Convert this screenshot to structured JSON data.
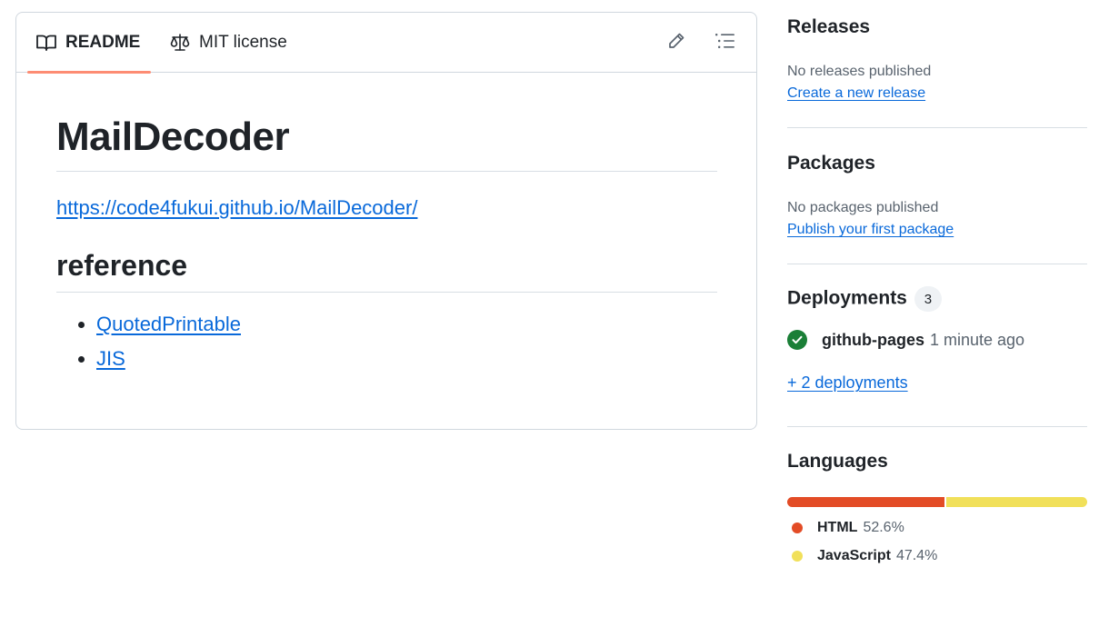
{
  "readme": {
    "tabs": [
      {
        "label": "README",
        "icon": "book-icon",
        "active": true
      },
      {
        "label": "MIT license",
        "icon": "law-icon",
        "active": false
      }
    ],
    "title": "MailDecoder",
    "site_link": "https://code4fukui.github.io/MailDecoder/",
    "reference_heading": "reference",
    "references": [
      "QuotedPrintable",
      "JIS"
    ]
  },
  "sidebar": {
    "releases": {
      "title": "Releases",
      "status": "No releases published",
      "link": "Create a new release"
    },
    "packages": {
      "title": "Packages",
      "status": "No packages published",
      "link": "Publish your first package"
    },
    "deployments": {
      "title": "Deployments",
      "count": "3",
      "latest_name": "github-pages",
      "latest_time": "1 minute ago",
      "more_link": "+ 2 deployments"
    },
    "languages": {
      "title": "Languages",
      "items": [
        {
          "name": "HTML",
          "percent": "52.6%",
          "value": 52.6,
          "color": "#e34c26"
        },
        {
          "name": "JavaScript",
          "percent": "47.4%",
          "value": 47.4,
          "color": "#f1e05a"
        }
      ]
    }
  },
  "colors": {
    "link": "#0969da",
    "tab_underline": "#fd8c73",
    "success": "#1a7f37"
  }
}
